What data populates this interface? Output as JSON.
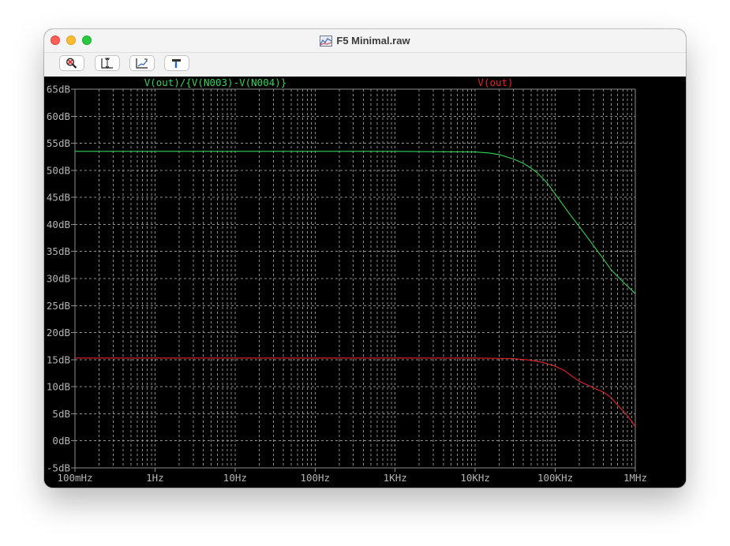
{
  "window": {
    "title": "F5 Minimal.raw"
  },
  "toolbar": {
    "buttons": [
      {
        "icon": "magnifier-zoom-icon"
      },
      {
        "icon": "autorange-icon"
      },
      {
        "icon": "zoom-fit-icon"
      },
      {
        "icon": "hammer-icon"
      }
    ]
  },
  "colors": {
    "background": "#000000",
    "grid": "#8c8c8c",
    "axis_text": "#b4b4b4",
    "series1": "#33d35a",
    "series2": "#e8242a"
  },
  "chart_data": {
    "type": "line",
    "title": "",
    "x_scale": "log",
    "xlim": [
      0.1,
      1000000
    ],
    "ylim": [
      -5,
      65
    ],
    "x_ticks": [
      0.1,
      1,
      10,
      100,
      1000,
      10000,
      100000,
      1000000
    ],
    "x_tick_labels": [
      "100mHz",
      "1Hz",
      "10Hz",
      "100Hz",
      "1KHz",
      "10KHz",
      "100KHz",
      "1MHz"
    ],
    "y_ticks": [
      -5,
      0,
      5,
      10,
      15,
      20,
      25,
      30,
      35,
      40,
      45,
      50,
      55,
      60,
      65
    ],
    "y_tick_labels": [
      "-5dB",
      "0dB",
      "5dB",
      "10dB",
      "15dB",
      "20dB",
      "25dB",
      "30dB",
      "35dB",
      "40dB",
      "45dB",
      "50dB",
      "55dB",
      "60dB",
      "65dB"
    ],
    "grid": true,
    "series": [
      {
        "name": "V(out)/{V(N003)-V(N004)}",
        "color": "#33d35a",
        "x": [
          0.1,
          1,
          10,
          100,
          1000,
          10000,
          15000,
          20000,
          30000,
          40000,
          50000,
          60000,
          70000,
          80000,
          100000,
          150000,
          200000,
          300000,
          400000,
          500000,
          700000,
          1000000
        ],
        "y": [
          53.5,
          53.5,
          53.5,
          53.5,
          53.5,
          53.4,
          53.2,
          52.9,
          52.1,
          51.3,
          50.4,
          49.5,
          48.5,
          47.6,
          45.6,
          42.0,
          39.6,
          36.1,
          33.6,
          31.6,
          29.4,
          27.2
        ]
      },
      {
        "name": "V(out)",
        "color": "#e8242a",
        "x": [
          0.1,
          1,
          10,
          100,
          1000,
          10000,
          30000,
          50000,
          70000,
          100000,
          130000,
          160000,
          200000,
          300000,
          400000,
          500000,
          600000,
          700000,
          800000,
          900000,
          1000000
        ],
        "y": [
          15.3,
          15.3,
          15.3,
          15.3,
          15.3,
          15.3,
          15.2,
          14.9,
          14.5,
          13.8,
          13.0,
          12.0,
          11.0,
          9.8,
          9.0,
          8.0,
          6.6,
          5.6,
          4.6,
          3.6,
          2.6
        ]
      }
    ]
  }
}
